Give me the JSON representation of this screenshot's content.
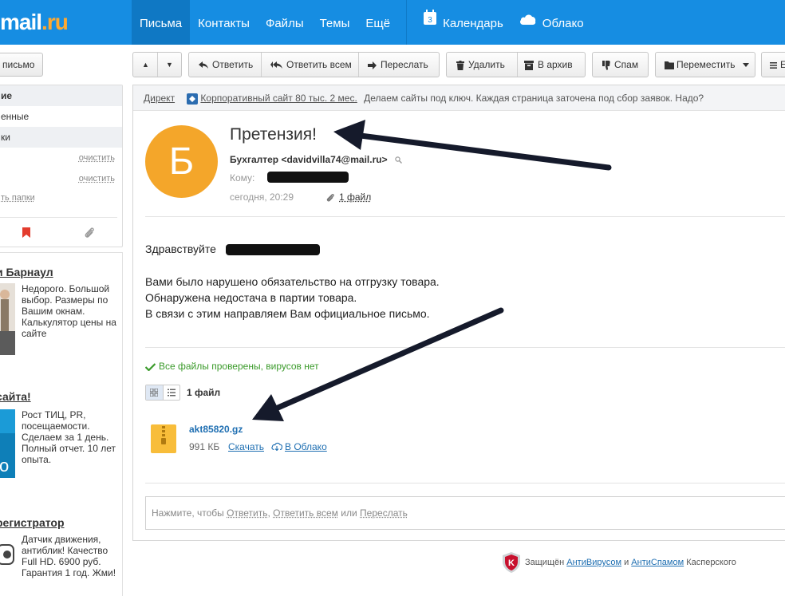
{
  "header": {
    "logo_main": "mail",
    "logo_dot": ".",
    "logo_ru": "ru",
    "nav": [
      "Письма",
      "Контакты",
      "Файлы",
      "Темы",
      "Ещё"
    ],
    "calendar_day": "3",
    "calendar": "Календарь",
    "cloud": "Облако"
  },
  "left": {
    "write_label": "письмо",
    "folders": [
      "ие",
      "енные",
      "ки"
    ],
    "clear_labels": [
      "очистить",
      "очистить"
    ],
    "folder_settings": "ть папки"
  },
  "ads": [
    {
      "title": "и Барнаул",
      "text": "Недорого. Большой выбор. Размеры по Вашим окнам. Калькулятор цены на сайте"
    },
    {
      "title": "сайта!",
      "text": "Рост ТИЦ, PR, посещаемости. Сделаем за 1 день. Полный отчет. 10 лет опыта."
    },
    {
      "title": "регистратор",
      "text": "Датчик движения, антиблик! Качество Full HD. 6900 руб. Гарантия 1 год. Жми!"
    }
  ],
  "toolbar": {
    "up": "▲",
    "down": "▼",
    "reply": "Ответить",
    "reply_all": "Ответить всем",
    "forward": "Переслать",
    "delete": "Удалить",
    "archive": "В архив",
    "spam": "Спам",
    "move": "Переместить",
    "more": "Е"
  },
  "direct": {
    "label": "Директ",
    "link": "Корпоративный сайт 80 тыс. 2 мес.",
    "text": "Делаем сайты под ключ. Каждая страница заточена под сбор заявок. Надо?"
  },
  "letter": {
    "avatar_letter": "Б",
    "subject": "Претензия!",
    "from": "Бухгалтер <davidvilla74@mail.ru>",
    "to_label": "Кому:",
    "date": "сегодня, 20:29",
    "attachments_link": "1 файл",
    "greeting_start": "Здравствуйте",
    "greeting_end": "!",
    "body_lines": [
      "Вами было нарушено обязательство на отгрузку товара.",
      "Обнаружена недостача в партии товара.",
      "В связи с этим направляем Вам официальное письмо."
    ],
    "verified": "Все файлы проверены, вирусов нет",
    "files_count": "1 файл",
    "file_name": "akt85820.gz",
    "file_size": "991 КБ",
    "download": "Скачать",
    "to_cloud": "В Облако"
  },
  "reply": {
    "prefix": "Нажмите, чтобы",
    "reply": "Ответить",
    "sep1": ",",
    "reply_all": "Ответить всем",
    "or": "или",
    "forward": "Переслать"
  },
  "footer": {
    "prefix": "Защищён",
    "antivirus": "АнтиВирусом",
    "and": "и",
    "antispam": "АнтиСпамом",
    "suffix": "Касперского"
  },
  "colors": {
    "header_blue": "#168de2",
    "avatar_orange": "#f4a62a",
    "link_blue": "#1f6fb2",
    "verified_green": "#3a9a2a"
  }
}
